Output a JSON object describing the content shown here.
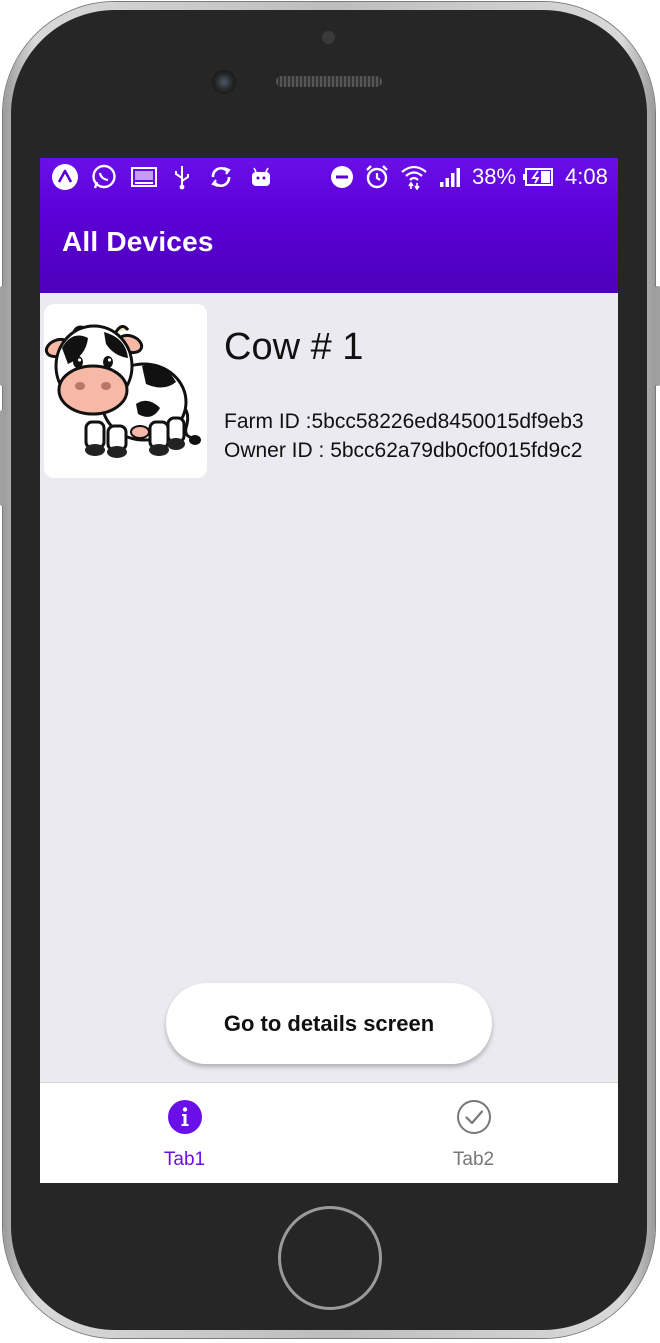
{
  "status_bar": {
    "battery": "38%",
    "time": "4:08",
    "icons_left": [
      "app-a-icon",
      "whatsapp-icon",
      "gallery-icon",
      "usb-icon",
      "sync-icon",
      "android-icon"
    ],
    "icons_right": [
      "dnd-icon",
      "alarm-icon",
      "wifi-icon",
      "signal-icon",
      "battery-icon"
    ]
  },
  "header": {
    "title": "All Devices",
    "color": "#5a00d6"
  },
  "device": {
    "name": "Cow # 1",
    "farm_id": "Farm ID :5bcc58226ed8450015df9eb3",
    "owner_id": "Owner ID : 5bcc62a79db0cf0015fd9c2",
    "image": "cow-icon"
  },
  "actions": {
    "details_label": "Go to details screen"
  },
  "tabs": [
    {
      "label": "Tab1",
      "icon": "info-icon",
      "active": true,
      "color": "#6a0fe8"
    },
    {
      "label": "Tab2",
      "icon": "check-circle-icon",
      "active": false,
      "color": "#777777"
    }
  ]
}
